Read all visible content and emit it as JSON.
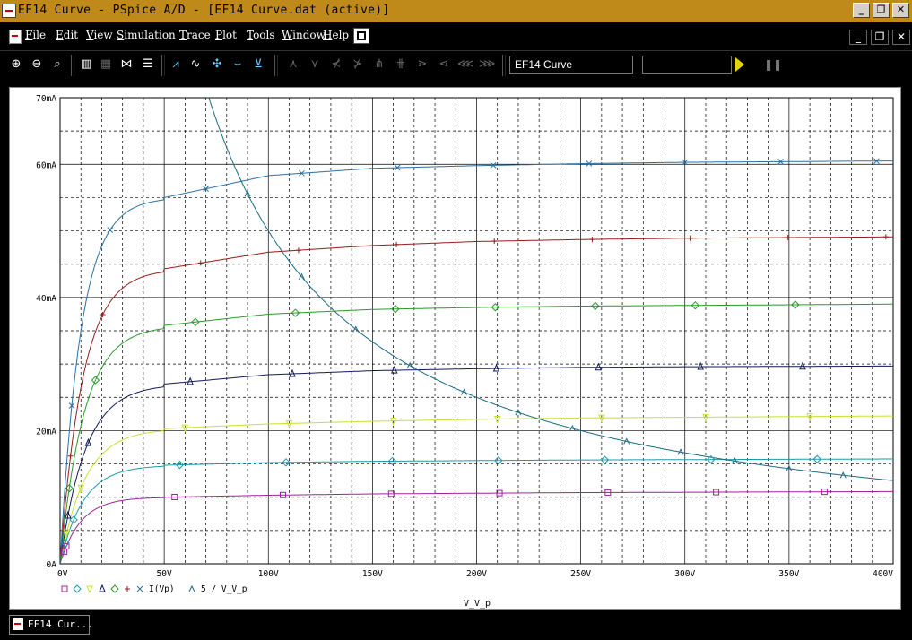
{
  "window": {
    "title": "EF14 Curve - PSpice A/D  - [EF14 Curve.dat (active)]",
    "controls": {
      "minimize": "_",
      "restore": "❐",
      "close": "✕"
    }
  },
  "menu": {
    "items": [
      {
        "key": "F",
        "rest": "ile"
      },
      {
        "key": "E",
        "rest": "dit"
      },
      {
        "key": "V",
        "rest": "iew"
      },
      {
        "key": "S",
        "rest": "imulation"
      },
      {
        "key": "T",
        "rest": "race"
      },
      {
        "key": "P",
        "rest": "lot"
      },
      {
        "key": "T",
        "rest": "ools"
      },
      {
        "key": "W",
        "rest": "indow"
      },
      {
        "key": "H",
        "rest": "elp"
      }
    ],
    "mdi_controls": {
      "minimize": "_",
      "restore": "❐",
      "close": "✕"
    }
  },
  "toolbar": {
    "profile": "EF14 Curve",
    "icons": [
      "zoom-in-icon",
      "zoom-out-icon",
      "zoom-area-icon",
      "zoom-fit-icon",
      "log-x-icon",
      "fourier-icon",
      "performance-icon",
      "add-trace-icon",
      "trace-expression-icon",
      "toggle-cursor-icon",
      "mark-label-icon"
    ]
  },
  "taskbar": {
    "tab_label": "EF14 Cur..."
  },
  "chart_data": {
    "type": "line",
    "xlabel": "V_V_p",
    "x_ticks": [
      "0V",
      "50V",
      "100V",
      "150V",
      "200V",
      "250V",
      "300V",
      "350V",
      "400V"
    ],
    "y_ticks": [
      "0A",
      "20mA",
      "40mA",
      "60mA",
      "70mA"
    ],
    "xlim": [
      0,
      400
    ],
    "ylim": [
      0,
      70
    ],
    "grid": true,
    "legend": {
      "placement": "bottom-left",
      "expression_1": "I(Vp)",
      "expression_2": "5 / V_V_p",
      "symbols": [
        "□",
        "◇",
        "▽",
        "△",
        "◇",
        "+",
        "×",
        "∧"
      ]
    },
    "series": [
      {
        "color": "#a0209a",
        "marker": "square",
        "vsat": 1.8,
        "values_mA": [
          0,
          10.0,
          10.3,
          10.5,
          10.6,
          10.7,
          10.75,
          10.8,
          10.85
        ]
      },
      {
        "color": "#1a9aaa",
        "marker": "diamond",
        "vsat": 2.0,
        "values_mA": [
          0,
          14.8,
          15.2,
          15.4,
          15.5,
          15.6,
          15.65,
          15.7,
          15.75
        ]
      },
      {
        "color": "#c8e030",
        "marker": "triangle-down",
        "vsat": 2.2,
        "values_mA": [
          0,
          20.3,
          21.0,
          21.4,
          21.7,
          21.9,
          22.0,
          22.1,
          22.2
        ]
      },
      {
        "color": "#101a5a",
        "marker": "triangle",
        "vsat": 2.2,
        "values_mA": [
          0,
          27.0,
          28.4,
          29.0,
          29.3,
          29.5,
          29.6,
          29.65,
          29.7
        ]
      },
      {
        "color": "#2a9a2a",
        "marker": "diamond",
        "vsat": 2.1,
        "values_mA": [
          0,
          35.8,
          37.5,
          38.2,
          38.5,
          38.7,
          38.8,
          38.9,
          39.0
        ]
      },
      {
        "color": "#9a1a1a",
        "marker": "plus",
        "vsat": 2.0,
        "values_mA": [
          0,
          44.3,
          46.8,
          47.8,
          48.4,
          48.7,
          48.9,
          49.0,
          49.1
        ]
      },
      {
        "color": "#2a70a0",
        "marker": "x",
        "vsat": 1.8,
        "values_mA": [
          0,
          55.0,
          58.3,
          59.4,
          59.8,
          60.1,
          60.3,
          60.4,
          60.5
        ]
      }
    ],
    "hyperbola": {
      "color": "#1a6a80",
      "marker": "caret",
      "expression": "5 / V_V_p",
      "scale_mA": 5000
    }
  }
}
